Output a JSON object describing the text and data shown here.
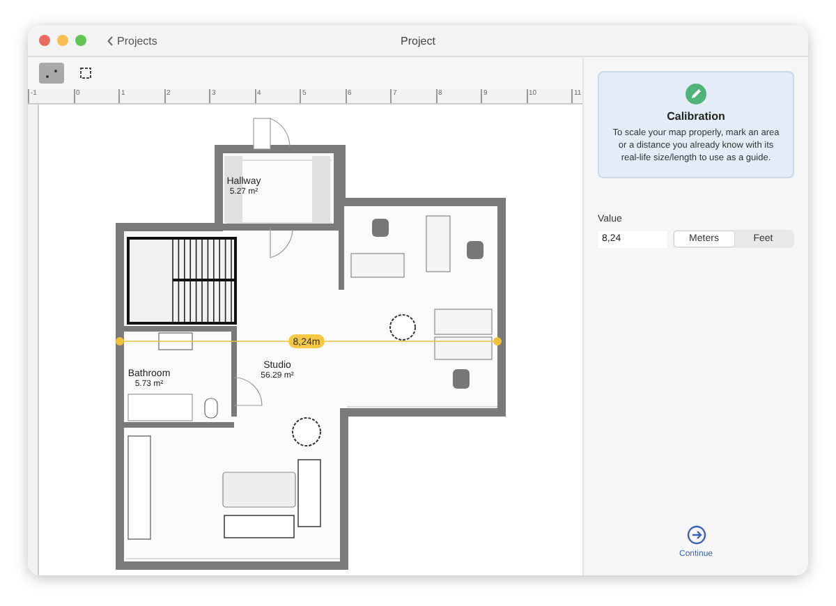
{
  "window": {
    "title": "Project",
    "back_label": "Projects"
  },
  "tools": [
    {
      "kind": "points",
      "selected": true
    },
    {
      "kind": "frame",
      "selected": false
    }
  ],
  "ruler": {
    "labels": [
      "-1",
      "0",
      "1",
      "2",
      "3",
      "4",
      "5",
      "6",
      "7",
      "8",
      "9",
      "10",
      "11"
    ]
  },
  "plan": {
    "rooms": [
      {
        "name": "Hallway",
        "area": "5.27 m²"
      },
      {
        "name": "Studio",
        "area": "56.29 m²"
      },
      {
        "name": "Bathroom",
        "area": "5.73 m²"
      }
    ],
    "measurement": "8,24m"
  },
  "panel": {
    "title": "Calibration",
    "description": "To scale your map properly, mark an area or a distance you already know with its real-life size/length to use as a guide.",
    "value_label": "Value",
    "value": "8,24",
    "units": [
      {
        "label": "Meters",
        "selected": true
      },
      {
        "label": "Feet",
        "selected": false
      }
    ],
    "continue_label": "Continue"
  }
}
